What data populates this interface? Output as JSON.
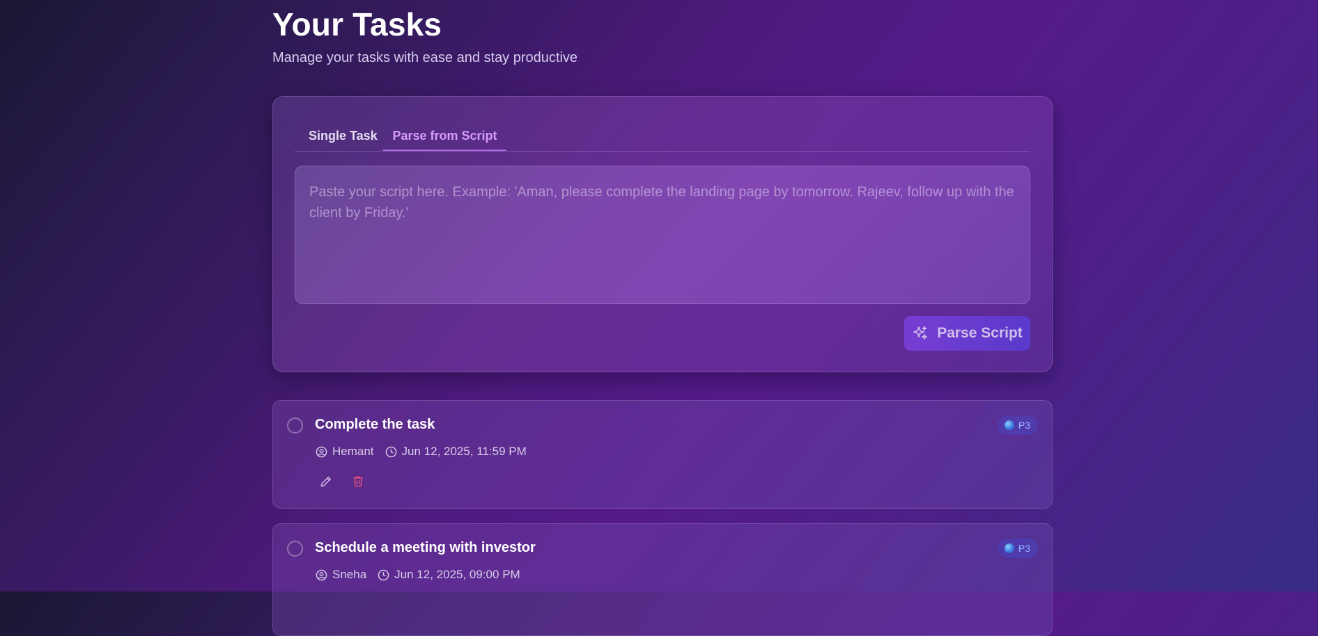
{
  "header": {
    "title": "Your Tasks",
    "subtitle": "Manage your tasks with ease and stay productive"
  },
  "composer": {
    "tabs": [
      {
        "label": "Single Task",
        "active": false
      },
      {
        "label": "Parse from Script",
        "active": true
      }
    ],
    "script_placeholder": "Paste your script here. Example: 'Aman, please complete the landing page by tomorrow. Rajeev, follow up with the client by Friday.'",
    "script_value": "",
    "parse_button_label": "Parse Script",
    "parse_button_icon": "sparkles-icon"
  },
  "tasks": [
    {
      "title": "Complete the task",
      "assignee": "Hemant",
      "due": "Jun 12, 2025, 11:59 PM",
      "priority": "P3",
      "completed": false
    },
    {
      "title": "Schedule a meeting with investor",
      "assignee": "Sneha",
      "due": "Jun 12, 2025, 09:00 PM",
      "priority": "P3",
      "completed": false
    }
  ],
  "colors": {
    "accent": "#b56ff3",
    "button_gradient_start": "#7a3fd8",
    "button_gradient_end": "#5a3bd0",
    "priority_badge_text": "#9bb4ff",
    "delete_icon": "#e0507a"
  }
}
